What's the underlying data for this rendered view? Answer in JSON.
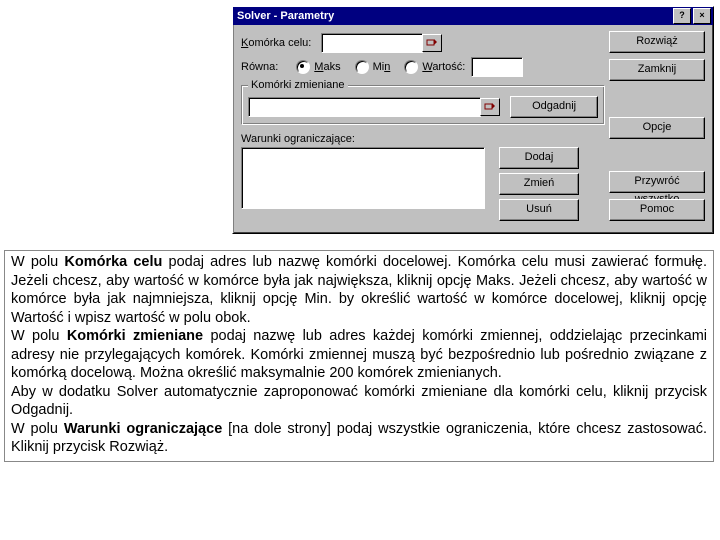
{
  "dialog": {
    "title": "Solver - Parametry",
    "help_btn": "?",
    "close_btn": "×",
    "labels": {
      "target_cell": "Komórka celu:",
      "equals": "Równa:",
      "max": "Maks",
      "min": "Min",
      "value": "Wartość:",
      "changing": "Komórki zmieniane",
      "constraints": "Warunki ograniczające:"
    },
    "fields": {
      "target_value": "",
      "value_value": "",
      "changing_value": ""
    },
    "buttons": {
      "solve": "Rozwiąż",
      "close": "Zamknij",
      "guess": "Odgadnij",
      "options": "Opcje",
      "add": "Dodaj",
      "change": "Zmień",
      "delete": "Usuń",
      "reset": "Przywróć wszystko",
      "help": "Pomoc"
    }
  },
  "explain": {
    "p1_a": "W polu ",
    "p1_b": "Komórka celu",
    "p1_c": " podaj adres lub nazwę komórki docelowej. Komórka celu musi zawierać formułę. Jeżeli chcesz, aby wartość w komórce była jak największa, kliknij opcję Maks. Jeżeli chcesz, aby wartość w komórce była jak najmniejsza, kliknij opcję Min. by określić wartość w komórce docelowej, kliknij opcję Wartość i wpisz wartość w polu obok.",
    "p2_a": "W polu ",
    "p2_b": "Komórki zmieniane",
    "p2_c": " podaj nazwę lub adres każdej komórki zmiennej, oddzielając przecinkami adresy nie przylegających komórek. Komórki zmiennej muszą być bezpośrednio lub pośrednio związane z komórką docelową. Można określić maksymalnie 200 komórek zmienianych.",
    "p3": "Aby w dodatku Solver automatycznie zaproponować komórki zmieniane dla komórki celu, kliknij przycisk Odgadnij.",
    "p4_a": "W polu ",
    "p4_b": "Warunki ograniczające",
    "p4_c": " [na dole strony] podaj wszystkie ograniczenia, które chcesz zastosować. Kliknij przycisk Rozwiąż."
  }
}
